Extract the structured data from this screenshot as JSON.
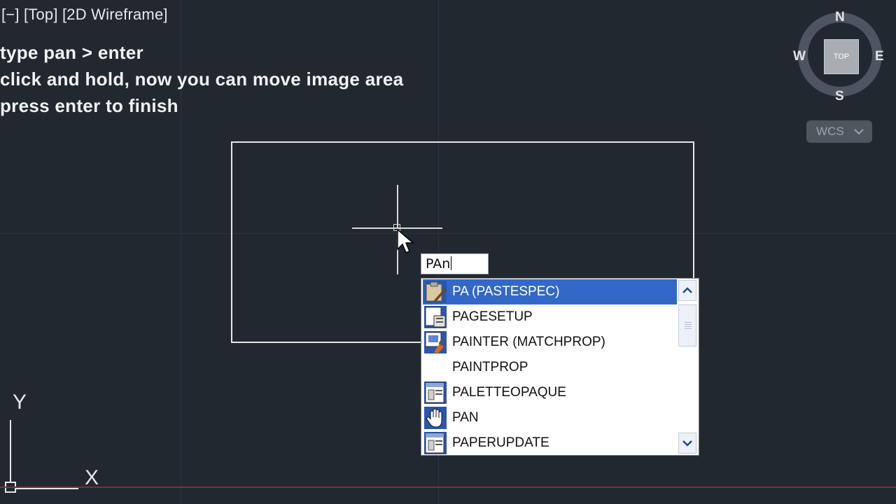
{
  "viewport": {
    "label": "[−] [Top] [2D Wireframe]"
  },
  "instructions": [
    "type pan > enter",
    "click and hold, now you can move image area",
    "press enter to finish"
  ],
  "command_input": {
    "value": "PAn"
  },
  "autocomplete": {
    "items": [
      {
        "label": "PA (PASTESPEC)",
        "icon": "paste-special-icon",
        "selected": true
      },
      {
        "label": "PAGESETUP",
        "icon": "page-setup-icon",
        "selected": false
      },
      {
        "label": "PAINTER (MATCHPROP)",
        "icon": "paint-brush-icon",
        "selected": false
      },
      {
        "label": "PAINTPROP",
        "icon": "",
        "selected": false
      },
      {
        "label": "PALETTEOPAQUE",
        "icon": "palette-icon",
        "selected": false
      },
      {
        "label": "PAN",
        "icon": "hand-pan-icon",
        "selected": false
      },
      {
        "label": "PAPERUPDATE",
        "icon": "paper-update-icon",
        "selected": false
      }
    ]
  },
  "viewcube": {
    "face": "TOP",
    "north": "N",
    "south": "S",
    "east": "E",
    "west": "W",
    "wcs": "WCS"
  },
  "ucs": {
    "y": "Y",
    "x": "X"
  },
  "colors": {
    "background": "#212830",
    "selection": "#3468c8",
    "x_axis": "#8a2a2a"
  }
}
